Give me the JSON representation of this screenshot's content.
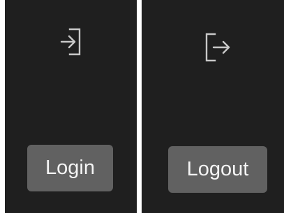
{
  "left_panel": {
    "icon": "login-arrow-into-door-icon",
    "button_label": "Login"
  },
  "right_panel": {
    "icon": "logout-arrow-out-of-door-icon",
    "button_label": "Logout"
  },
  "colors": {
    "panel_background": "#1f1f1f",
    "button_background": "#616161",
    "button_text": "#f4f4f4",
    "icon_stroke": "#c8c8c8",
    "divider": "#ffffff"
  }
}
